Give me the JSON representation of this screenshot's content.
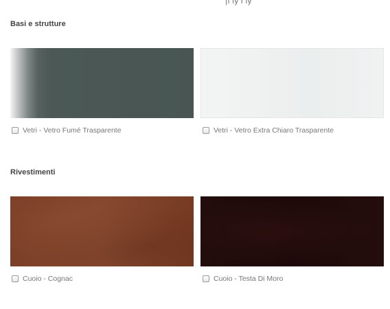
{
  "top_fragment": "ٰ|ıٰ ıy ıٰ ıy",
  "sections": [
    {
      "title": "Basi e strutture",
      "items": [
        {
          "label": "Vetri - Vetro Fumé Trasparente",
          "checked": false,
          "swatch": "smoke-glass"
        },
        {
          "label": "Vetri - Vetro Extra Chiaro Trasparente",
          "checked": false,
          "swatch": "extra-clear-glass"
        }
      ]
    },
    {
      "title": "Rivestimenti",
      "items": [
        {
          "label": "Cuoio - Cognac",
          "checked": false,
          "swatch": "cognac-leather"
        },
        {
          "label": "Cuoio - Testa Di Moro",
          "checked": false,
          "swatch": "testa-di-moro-leather"
        }
      ]
    }
  ],
  "colors": {
    "smoke_glass": "#4a5755",
    "extra_clear_glass": "#eef1f0",
    "cognac": "#7a3f27",
    "testa_di_moro": "#1f0b0b"
  }
}
